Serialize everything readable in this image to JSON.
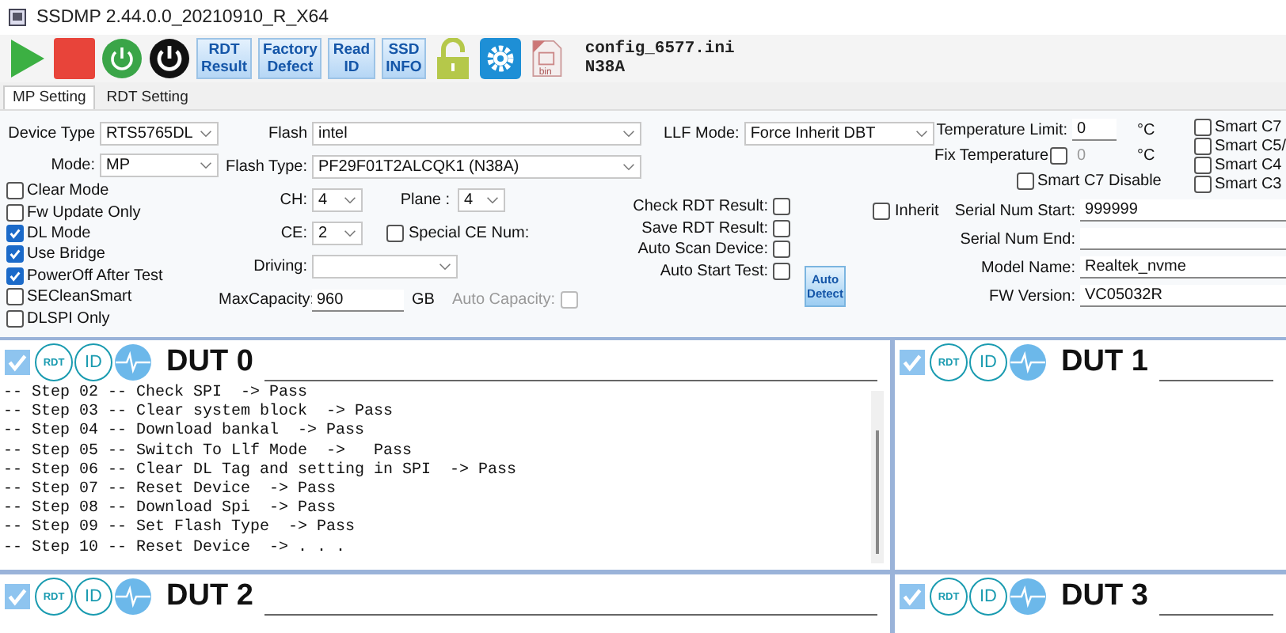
{
  "window": {
    "title": "SSDMP 2.44.0.0_20210910_R_X64"
  },
  "toolbar": {
    "buttons": [
      {
        "kind": "play"
      },
      {
        "kind": "stop"
      },
      {
        "kind": "power-green"
      },
      {
        "kind": "power-black"
      },
      {
        "kind": "text",
        "lines": [
          "RDT",
          "Result"
        ]
      },
      {
        "kind": "text",
        "lines": [
          "Factory",
          "Defect"
        ]
      },
      {
        "kind": "text",
        "lines": [
          "Read",
          "ID"
        ]
      },
      {
        "kind": "text",
        "lines": [
          "SSD",
          "INFO"
        ]
      },
      {
        "kind": "lock"
      },
      {
        "kind": "gear"
      },
      {
        "kind": "bin",
        "caption": "bin"
      }
    ],
    "config_lines": [
      "config_6577.ini",
      "N38A"
    ]
  },
  "tabs": [
    {
      "label": "MP Setting",
      "selected": true
    },
    {
      "label": "RDT Setting",
      "selected": false
    }
  ],
  "settings": {
    "device_type": {
      "label": "Device Type",
      "value": "RTS5765DL"
    },
    "mode": {
      "label": "Mode:",
      "value": "MP"
    },
    "options": [
      {
        "label": "Clear Mode",
        "checked": false
      },
      {
        "label": "Fw Update Only",
        "checked": false
      },
      {
        "label": "DL Mode",
        "checked": true
      },
      {
        "label": "Use Bridge",
        "checked": true
      },
      {
        "label": "PowerOff After Test",
        "checked": true
      },
      {
        "label": "SECleanSmart",
        "checked": false
      },
      {
        "label": "DLSPI Only",
        "checked": false
      }
    ],
    "flash": {
      "label": "Flash",
      "value": "intel"
    },
    "flash_type": {
      "label": "Flash Type:",
      "value": "PF29F01T2ALCQK1 (N38A)"
    },
    "ch": {
      "label": "CH:",
      "value": "4"
    },
    "plane": {
      "label": "Plane :",
      "value": "4"
    },
    "ce": {
      "label": "CE:",
      "value": "2"
    },
    "special_ce": {
      "label": "Special CE Num:",
      "checked": false
    },
    "driving": {
      "label": "Driving:"
    },
    "max_capacity": {
      "label": "MaxCapacity:",
      "value": "960",
      "unit": "GB"
    },
    "auto_capacity": {
      "label": "Auto Capacity:",
      "checked": false,
      "disabled": true
    },
    "llf_mode": {
      "label": "LLF Mode:",
      "value": "Force Inherit DBT"
    },
    "rdt_options": [
      {
        "label": "Check RDT Result:",
        "checked": false
      },
      {
        "label": "Save RDT Result:",
        "checked": false
      },
      {
        "label": "Auto Scan Device:",
        "checked": false
      },
      {
        "label": "Auto Start Test:",
        "checked": false
      }
    ],
    "auto_detect": {
      "lines": [
        "Auto",
        "Detect"
      ]
    },
    "temperature_limit": {
      "label": "Temperature Limit:",
      "value": "0",
      "unit": "°C"
    },
    "fix_temperature": {
      "label": "Fix Temperature",
      "checked": false,
      "value": "0",
      "unit": "°C"
    },
    "smart_c7_disable": {
      "label": "Smart C7 Disable",
      "checked": false
    },
    "smart_options": [
      {
        "label": "Smart C7",
        "checked": false
      },
      {
        "label": "Smart C5/",
        "checked": false
      },
      {
        "label": "Smart C4",
        "checked": false
      },
      {
        "label": "Smart C3",
        "checked": false
      }
    ],
    "inherit": {
      "label": "Inherit",
      "checked": false
    },
    "serial_fields": [
      {
        "label": "Serial Num Start:",
        "value": "999999"
      },
      {
        "label": "Serial Num End:"
      },
      {
        "label": "Model Name:",
        "value": "Realtek_nvme"
      },
      {
        "label": "FW Version:",
        "value": "VC05032R"
      }
    ]
  },
  "duts": [
    {
      "title": "DUT 0",
      "checked": true,
      "icon_buttons": [
        "RDT",
        "ID"
      ],
      "log": [
        "-- Step 02 -- Check SPI  -> Pass",
        "-- Step 03 -- Clear system block  -> Pass",
        "-- Step 04 -- Download bankal  -> Pass",
        "-- Step 05 -- Switch To Llf Mode  ->   Pass",
        "-- Step 06 -- Clear DL Tag and setting in SPI  -> Pass",
        "-- Step 07 -- Reset Device  -> Pass",
        "-- Step 08 -- Download Spi  -> Pass",
        "-- Step 09 -- Set Flash Type  -> Pass",
        "-- Step 10 -- Reset Device  -> . . ."
      ]
    },
    {
      "title": "DUT 1",
      "checked": true,
      "icon_buttons": [
        "RDT",
        "ID"
      ]
    },
    {
      "title": "DUT 2",
      "checked": true,
      "icon_buttons": [
        "RDT",
        "ID"
      ]
    },
    {
      "title": "DUT 3",
      "checked": true,
      "icon_buttons": [
        "RDT",
        "ID"
      ]
    }
  ]
}
